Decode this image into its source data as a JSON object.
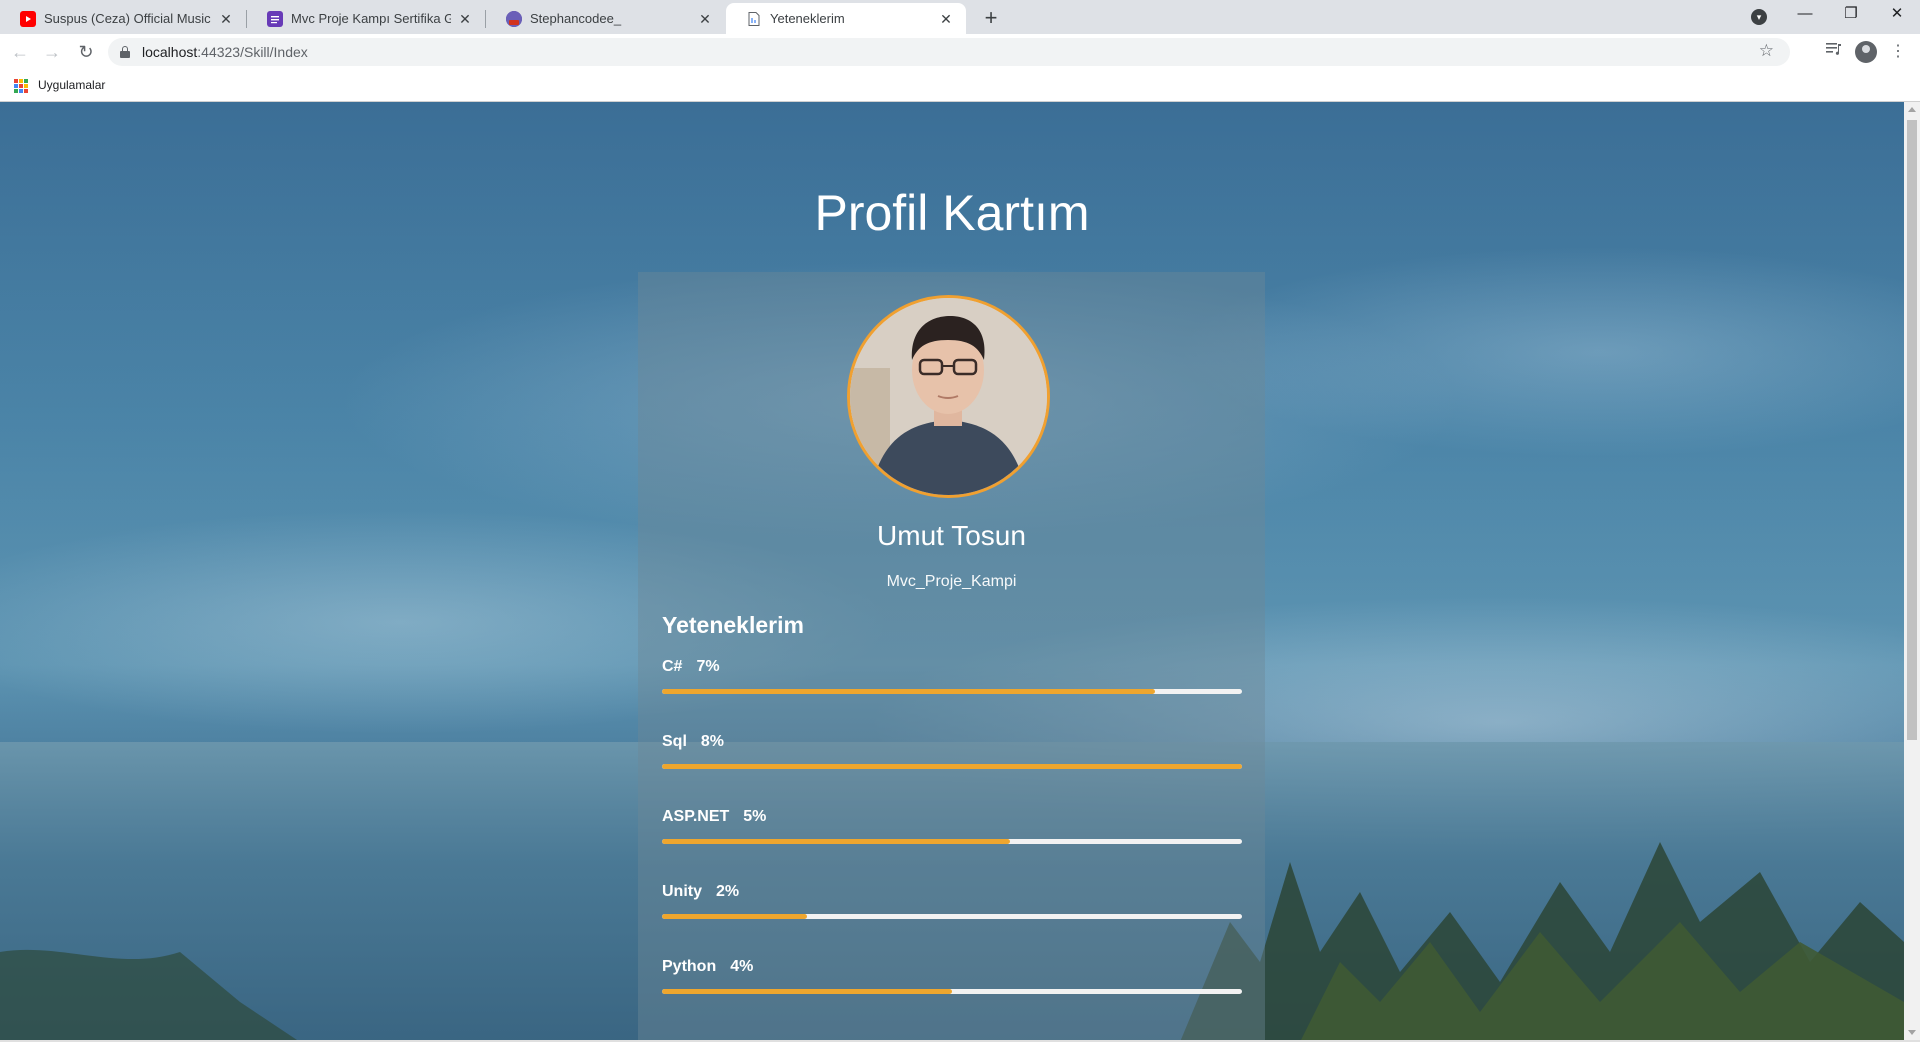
{
  "browser": {
    "tabs": [
      {
        "title": "Suspus (Ceza) Official Music Vide",
        "favicon": "youtube-icon",
        "active": false
      },
      {
        "title": "Mvc Proje Kampı Sertifika Görev",
        "favicon": "forms-icon",
        "active": false
      },
      {
        "title": "Stephancodee_",
        "favicon": "twitch-avatar-icon",
        "active": false
      },
      {
        "title": "Yeteneklerim",
        "favicon": "page-icon",
        "active": true
      }
    ],
    "url_host": "localhost",
    "url_path": ":44323/Skill/Index",
    "bookmarks": {
      "apps_label": "Uygulamalar"
    }
  },
  "page": {
    "title": "Profil Kartım",
    "profile": {
      "name": "Umut Tosun",
      "subtitle": "Mvc_Proje_Kampi"
    },
    "skills_heading": "Yeteneklerim",
    "skills": [
      {
        "name": "C#",
        "percent_label": "7%",
        "fill": 0.85
      },
      {
        "name": "Sql",
        "percent_label": "8%",
        "fill": 1.0
      },
      {
        "name": "ASP.NET",
        "percent_label": "5%",
        "fill": 0.6
      },
      {
        "name": "Unity",
        "percent_label": "2%",
        "fill": 0.25
      },
      {
        "name": "Python",
        "percent_label": "4%",
        "fill": 0.5
      }
    ]
  },
  "colors": {
    "accent": "#eea62e",
    "avatar_border": "#f0a030"
  }
}
